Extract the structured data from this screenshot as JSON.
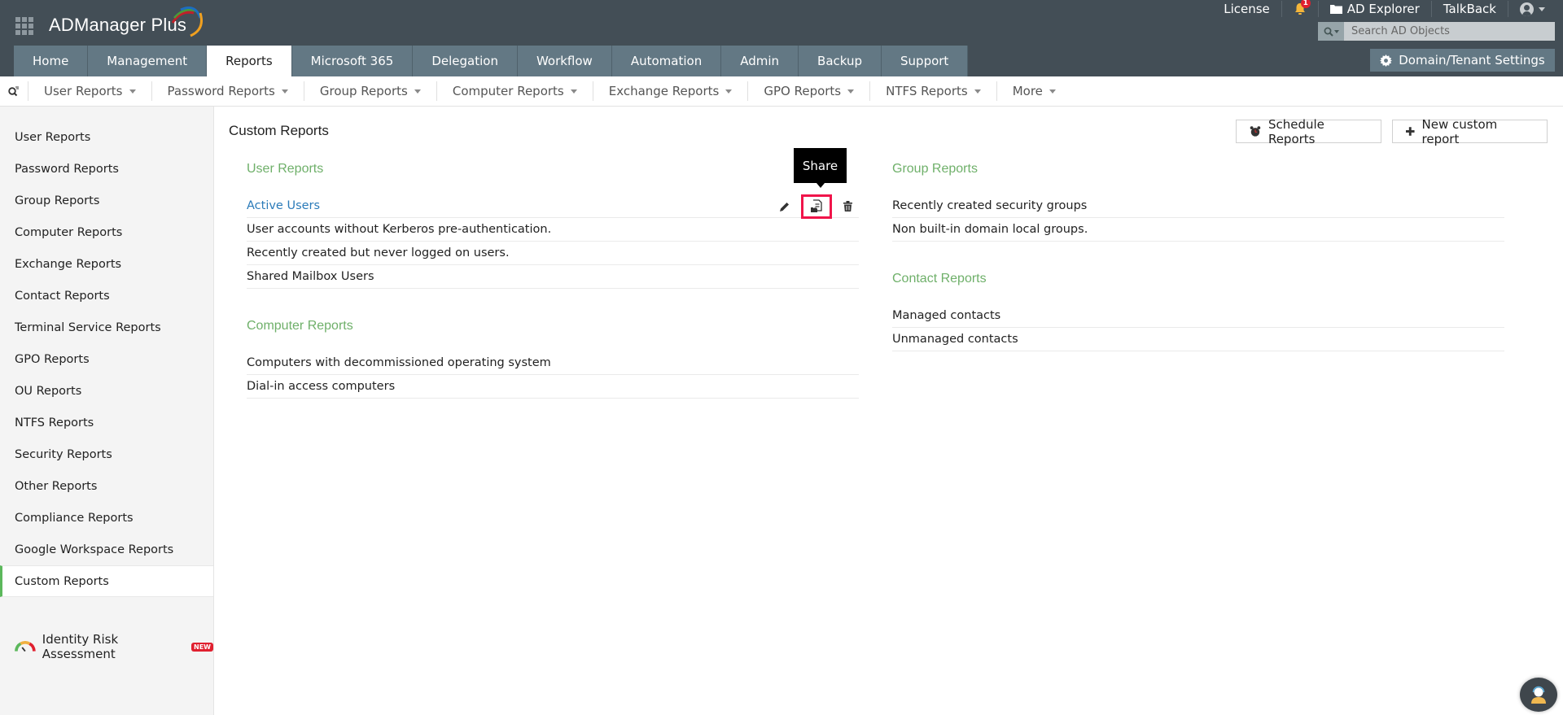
{
  "app": {
    "name": "ADManager Plus"
  },
  "top_links": {
    "license": "License",
    "notifications_count": "1",
    "ad_explorer": "AD Explorer",
    "talkback": "TalkBack"
  },
  "search": {
    "placeholder": "Search AD Objects",
    "value": ""
  },
  "domain_settings_label": "Domain/Tenant Settings",
  "nav_tabs": [
    {
      "label": "Home"
    },
    {
      "label": "Management"
    },
    {
      "label": "Reports",
      "active": true
    },
    {
      "label": "Microsoft 365"
    },
    {
      "label": "Delegation"
    },
    {
      "label": "Workflow"
    },
    {
      "label": "Automation"
    },
    {
      "label": "Admin"
    },
    {
      "label": "Backup"
    },
    {
      "label": "Support"
    }
  ],
  "subnav": [
    {
      "label": "User Reports"
    },
    {
      "label": "Password Reports"
    },
    {
      "label": "Group Reports"
    },
    {
      "label": "Computer Reports"
    },
    {
      "label": "Exchange Reports"
    },
    {
      "label": "GPO Reports"
    },
    {
      "label": "NTFS Reports"
    },
    {
      "label": "More"
    }
  ],
  "sidebar": {
    "items": [
      {
        "label": "User Reports"
      },
      {
        "label": "Password Reports"
      },
      {
        "label": "Group Reports"
      },
      {
        "label": "Computer Reports"
      },
      {
        "label": "Exchange Reports"
      },
      {
        "label": "Contact Reports"
      },
      {
        "label": "Terminal Service Reports"
      },
      {
        "label": "GPO Reports"
      },
      {
        "label": "OU Reports"
      },
      {
        "label": "NTFS Reports"
      },
      {
        "label": "Security Reports"
      },
      {
        "label": "Other Reports"
      },
      {
        "label": "Compliance Reports"
      },
      {
        "label": "Google Workspace Reports"
      },
      {
        "label": "Custom Reports",
        "active": true
      }
    ],
    "identity_risk": {
      "label": "Identity Risk Assessment",
      "badge": "NEW"
    }
  },
  "main": {
    "title": "Custom Reports",
    "schedule_label": "Schedule Reports",
    "new_report_label": "New custom report",
    "tooltip": "Share",
    "left_sections": [
      {
        "title": "User Reports",
        "reports": [
          "Active Users",
          "User accounts without Kerberos pre-authentication.",
          "Recently created but never logged on users.",
          "Shared Mailbox Users"
        ]
      },
      {
        "title": "Computer Reports",
        "reports": [
          "Computers with decommissioned operating system",
          "Dial-in access computers"
        ]
      }
    ],
    "right_sections": [
      {
        "title": "Group Reports",
        "reports": [
          "Recently created security groups",
          "Non built-in domain local groups."
        ]
      },
      {
        "title": "Contact Reports",
        "reports": [
          "Managed contacts",
          "Unmanaged contacts"
        ]
      }
    ]
  },
  "colors": {
    "header_bg": "#434e56",
    "tab_bg": "#637884",
    "section_title": "#6fb06a",
    "link": "#2b7bb9",
    "highlight": "#f0144a",
    "active_marker": "#5cb85c"
  }
}
